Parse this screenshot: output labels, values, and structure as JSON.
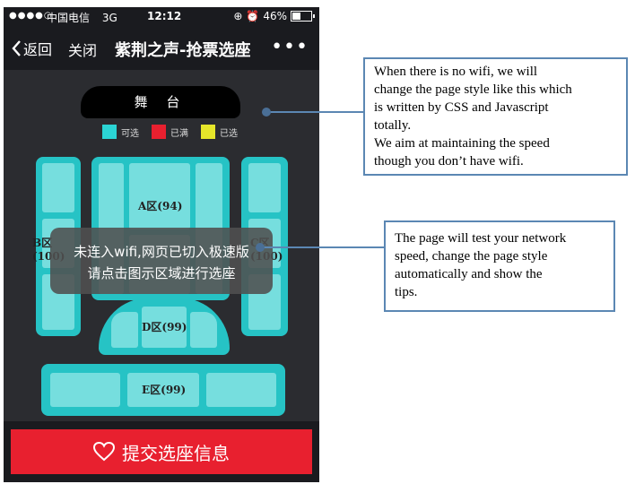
{
  "status_bar": {
    "signal": "●●●●○",
    "carrier": "中国电信",
    "network": "3G",
    "time": "12:12",
    "battery": "46%",
    "battery_level": 0.46
  },
  "nav": {
    "back_label": "返回",
    "close_label": "关闭",
    "title": "紫荆之声-抢票选座",
    "more_label": "•••"
  },
  "stage": {
    "label": "舞 台"
  },
  "legend": [
    {
      "label": "可选",
      "color": "#2bd4d4"
    },
    {
      "label": "已满",
      "color": "#e8202f"
    },
    {
      "label": "已选",
      "color": "#e6e62a"
    }
  ],
  "sections": {
    "a": "A区(94)",
    "b": "B区(100)",
    "c": "C区(100)",
    "d": "D区(99)",
    "e": "E区(99)"
  },
  "toast": {
    "line1": "未连入wifi,网页已切入极速版",
    "line2": "请点击图示区域进行选座"
  },
  "submit": {
    "label": "提交选座信息"
  },
  "callouts": {
    "first": [
      "When there is no wifi, we will",
      "change the page style like this which",
      "is written by CSS and Javascript",
      "totally.",
      "We aim at maintaining the speed",
      "though you don’t have wifi."
    ],
    "second": [
      "The page will test your network",
      "speed, change the page style",
      "automatically and show the",
      "tips."
    ]
  },
  "colors": {
    "phone_bg": "#1a1b1f",
    "seat_area_bg": "#2b2c30",
    "section_border": "#26c3c5",
    "section_fill": "#76dede",
    "submit_bg": "#e8202f",
    "callout_border": "#5b87b3"
  }
}
